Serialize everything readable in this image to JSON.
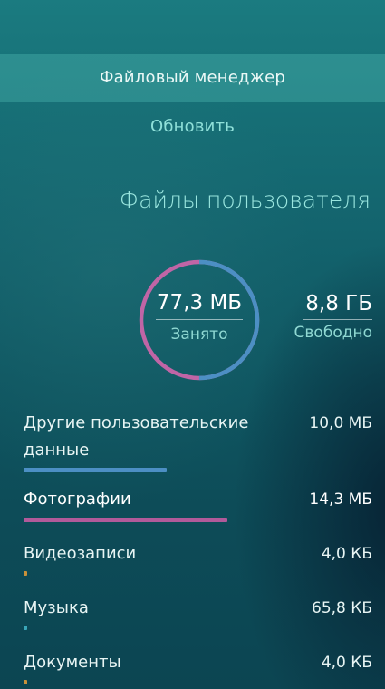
{
  "pulley_menu": {
    "highlighted_item": "Файловый менеджер",
    "item_2": "Обновить"
  },
  "page": {
    "title": "Файлы пользователя"
  },
  "storage": {
    "used_value": "77,3 МБ",
    "used_label": "Занято",
    "free_value": "8,8 ГБ",
    "free_label": "Свободно"
  },
  "categories": [
    {
      "label": "Другие пользовательские данные",
      "size": "10,0 МБ",
      "fraction": 0.41,
      "color": "#4c8fc4"
    },
    {
      "label": "Фотографии",
      "size": "14,3 МБ",
      "fraction": 0.585,
      "color": "#b15a9a"
    },
    {
      "label": "Видеозаписи",
      "size": "4,0 КБ",
      "fraction": 0.01,
      "color": "#c9913a"
    },
    {
      "label": "Музыка",
      "size": "65,8 КБ",
      "fraction": 0.01,
      "color": "#3aa7b8"
    },
    {
      "label": "Документы",
      "size": "4,0 КБ",
      "fraction": 0.01,
      "color": "#c9913a"
    }
  ],
  "ring": {
    "used_fraction_blue": 0.5,
    "blue_color": "#4c8fc4",
    "pink_color": "#c065a6"
  }
}
